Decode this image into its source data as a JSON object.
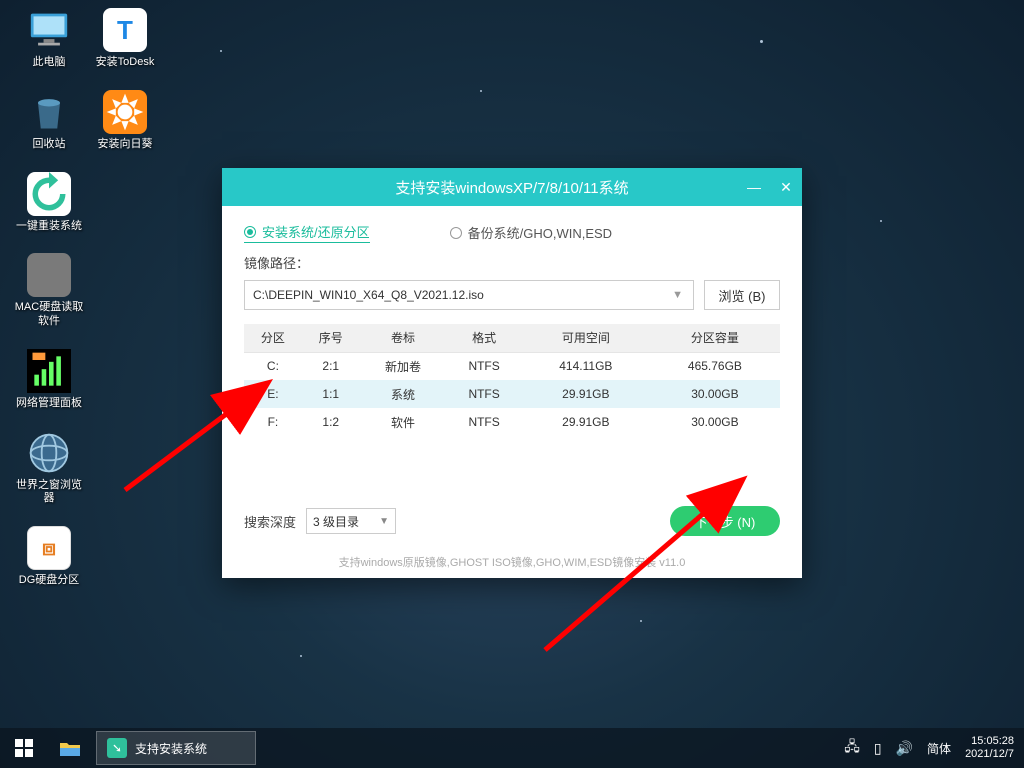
{
  "desktop": {
    "col1": [
      {
        "label": "此电脑",
        "icon": "pc"
      },
      {
        "label": "回收站",
        "icon": "bin"
      },
      {
        "label": "一键重装系统",
        "icon": "reinstall"
      },
      {
        "label": "MAC硬盘读取软件",
        "icon": "macdisk"
      },
      {
        "label": "网络管理面板",
        "icon": "neticon"
      },
      {
        "label": "世界之窗浏览器",
        "icon": "worldbrowser"
      },
      {
        "label": "DG硬盘分区",
        "icon": "dgdisk"
      }
    ],
    "col2": [
      {
        "label": "安装ToDesk",
        "icon": "todesk"
      },
      {
        "label": "安装向日葵",
        "icon": "sunflower"
      }
    ]
  },
  "window": {
    "title": "支持安装windowsXP/7/8/10/11系统",
    "radio_install": "安装系统/还原分区",
    "radio_backup": "备份系统/GHO,WIN,ESD",
    "path_label": "镜像路径：",
    "path_value": "C:\\DEEPIN_WIN10_X64_Q8_V2021.12.iso",
    "browse": "浏览 (B)",
    "headers": [
      "分区",
      "序号",
      "卷标",
      "格式",
      "可用空间",
      "分区容量"
    ],
    "rows": [
      {
        "p": "C:",
        "n": "2:1",
        "v": "新加卷",
        "f": "NTFS",
        "free": "414.11GB",
        "size": "465.76GB",
        "selected": false
      },
      {
        "p": "E:",
        "n": "1:1",
        "v": "系统",
        "f": "NTFS",
        "free": "29.91GB",
        "size": "30.00GB",
        "selected": true
      },
      {
        "p": "F:",
        "n": "1:2",
        "v": "软件",
        "f": "NTFS",
        "free": "29.91GB",
        "size": "30.00GB",
        "selected": false
      }
    ],
    "depth_label": "搜索深度",
    "depth_value": "3 级目录",
    "next": "下一步 (N)",
    "footnote": "支持windows原版镜像,GHOST ISO镜像,GHO,WIM,ESD镜像安装 v11.0"
  },
  "taskbar": {
    "task_label": "支持安装系统",
    "ime": "简体",
    "time": "15:05:28",
    "date": "2021/12/7"
  }
}
